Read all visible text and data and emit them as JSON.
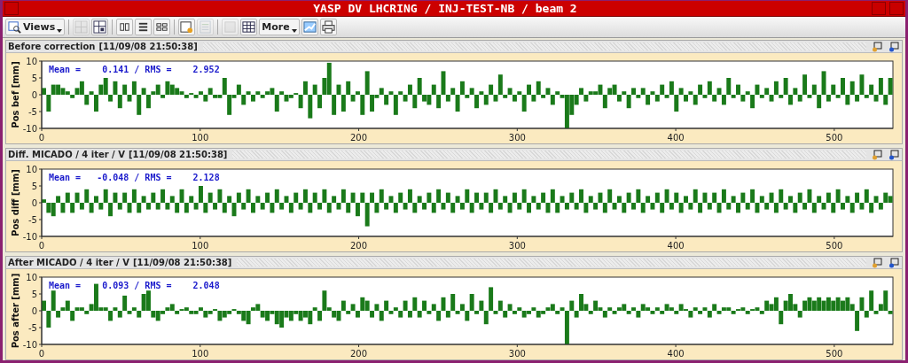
{
  "window": {
    "title": "YASP DV LHCRING / INJ-TEST-NB / beam 2"
  },
  "toolbar": [
    {
      "kind": "views",
      "label": "Views",
      "disabled": false
    },
    {
      "kind": "grid",
      "disabled": true
    },
    {
      "kind": "split",
      "disabled": false
    },
    {
      "kind": "columns",
      "disabled": false
    },
    {
      "kind": "rows",
      "disabled": false
    },
    {
      "kind": "tiles",
      "disabled": false
    },
    {
      "kind": "doc-gear",
      "disabled": false
    },
    {
      "kind": "list",
      "disabled": true
    },
    {
      "kind": "blank",
      "disabled": true
    },
    {
      "kind": "table",
      "disabled": false
    },
    {
      "kind": "more",
      "label": "More",
      "disabled": false
    },
    {
      "kind": "chart",
      "disabled": false
    },
    {
      "kind": "print",
      "disabled": false
    }
  ],
  "panels": [
    {
      "title": "Before correction",
      "timestamp": "[11/09/08 21:50:38]",
      "stats": "Mean =    0.141 / RMS =    2.952",
      "chart_data": {
        "type": "bar",
        "ylabel": "Pos bef [mm]",
        "xlim": [
          0,
          537
        ],
        "ylim": [
          -10,
          10
        ],
        "xticks": [
          0,
          100,
          200,
          300,
          400,
          500
        ],
        "yticks": [
          -10,
          -5,
          0,
          5,
          10
        ],
        "x": [
          1.5,
          4.5,
          7.5,
          10.5,
          13.5,
          16.5,
          19.5,
          22.5,
          25.5,
          28.5,
          31.5,
          34.5,
          37.5,
          40.5,
          43.5,
          46.5,
          49.5,
          52.5,
          55.5,
          58.5,
          61.5,
          64.5,
          67.5,
          70.5,
          73.5,
          76.5,
          79.5,
          82.5,
          85.5,
          88.5,
          91.5,
          94.5,
          97.5,
          100.5,
          103.5,
          106.5,
          109.5,
          112.5,
          115.5,
          118.5,
          121.5,
          124.5,
          127.5,
          130.5,
          133.5,
          136.5,
          139.5,
          142.5,
          145.5,
          148.5,
          151.5,
          154.5,
          157.5,
          160.5,
          163.5,
          166.5,
          169.5,
          172.5,
          175.5,
          178.5,
          181.5,
          184.5,
          187.5,
          190.5,
          193.5,
          196.5,
          199.5,
          202.5,
          205.5,
          208.5,
          211.5,
          214.5,
          217.5,
          220.5,
          223.5,
          226.5,
          229.5,
          232.5,
          235.5,
          238.5,
          241.5,
          244.5,
          247.5,
          250.5,
          253.5,
          256.5,
          259.5,
          262.5,
          265.5,
          268.5,
          271.5,
          274.5,
          277.5,
          280.5,
          283.5,
          286.5,
          289.5,
          292.5,
          295.5,
          298.5,
          301.5,
          304.5,
          307.5,
          310.5,
          313.5,
          316.5,
          319.5,
          322.5,
          325.5,
          328.5,
          331.5,
          334.5,
          337.5,
          340.5,
          343.5,
          346.5,
          349.5,
          352.5,
          355.5,
          358.5,
          361.5,
          364.5,
          367.5,
          370.5,
          373.5,
          376.5,
          379.5,
          382.5,
          385.5,
          388.5,
          391.5,
          394.5,
          397.5,
          400.5,
          403.5,
          406.5,
          409.5,
          412.5,
          415.5,
          418.5,
          421.5,
          424.5,
          427.5,
          430.5,
          433.5,
          436.5,
          439.5,
          442.5,
          445.5,
          448.5,
          451.5,
          454.5,
          457.5,
          460.5,
          463.5,
          466.5,
          469.5,
          472.5,
          475.5,
          478.5,
          481.5,
          484.5,
          487.5,
          490.5,
          493.5,
          496.5,
          499.5,
          502.5,
          505.5,
          508.5,
          511.5,
          514.5,
          517.5,
          520.5,
          523.5,
          526.5,
          529.5,
          532.5,
          535.5
        ],
        "series": [
          {
            "color": "#1a7a1a",
            "values": [
              2,
              -5,
              3,
              3,
              2,
              1,
              -1,
              2,
              4,
              -3,
              1,
              -5,
              3,
              5,
              -2,
              4,
              -4,
              3,
              -2,
              4,
              -6,
              2,
              -4,
              1,
              3,
              -1,
              4,
              3,
              2,
              1,
              -1,
              0.5,
              -1,
              1,
              -2,
              2,
              -1,
              -1,
              5,
              -6,
              -1,
              3,
              -3,
              1,
              -2,
              1,
              -1,
              1,
              2,
              -5,
              1,
              -2,
              -1,
              0.5,
              -4,
              4,
              -7,
              3,
              -4,
              5,
              9.5,
              -6,
              3,
              -5,
              4,
              -2,
              1,
              -6,
              7,
              -5,
              -1,
              2,
              -3,
              1,
              -6,
              1,
              -2,
              3,
              -4,
              5,
              -2,
              -3,
              3,
              -4,
              7,
              -2,
              2,
              -5,
              4,
              -1,
              2,
              -4,
              1,
              -3,
              3,
              -2,
              6,
              -1,
              2,
              -2,
              1,
              -5,
              3,
              -2,
              4,
              -1,
              2,
              -3,
              1,
              -1,
              -10,
              -6,
              -3,
              2,
              -2,
              1,
              1,
              3,
              -4,
              2,
              3,
              -2,
              1,
              -4,
              2,
              -1,
              2,
              -3,
              1,
              -2,
              3,
              -1,
              4,
              -5,
              2,
              -2,
              1,
              -3,
              3,
              -1,
              4,
              -2,
              2,
              -3,
              5,
              -1,
              3,
              -2,
              1,
              -4,
              3,
              -1,
              2,
              -2,
              4,
              -1,
              5,
              -3,
              2,
              -2,
              6,
              -1,
              3,
              -4,
              7,
              -2,
              3,
              -1,
              5,
              -3,
              4,
              -2,
              6,
              -1,
              3,
              -2,
              5,
              -3,
              5
            ]
          }
        ]
      }
    },
    {
      "title": "Diff. MICADO / 4 iter / V",
      "timestamp": "[11/09/08 21:50:38]",
      "stats": "Mean =   -0.048 / RMS =    2.128",
      "chart_data": {
        "type": "bar",
        "ylabel": "Pos diff [mm]",
        "xlim": [
          0,
          537
        ],
        "ylim": [
          -10,
          10
        ],
        "xticks": [
          0,
          100,
          200,
          300,
          400,
          500
        ],
        "yticks": [
          -10,
          -5,
          0,
          5,
          10
        ],
        "x": [
          1.5,
          4.5,
          7.5,
          10.5,
          13.5,
          16.5,
          19.5,
          22.5,
          25.5,
          28.5,
          31.5,
          34.5,
          37.5,
          40.5,
          43.5,
          46.5,
          49.5,
          52.5,
          55.5,
          58.5,
          61.5,
          64.5,
          67.5,
          70.5,
          73.5,
          76.5,
          79.5,
          82.5,
          85.5,
          88.5,
          91.5,
          94.5,
          97.5,
          100.5,
          103.5,
          106.5,
          109.5,
          112.5,
          115.5,
          118.5,
          121.5,
          124.5,
          127.5,
          130.5,
          133.5,
          136.5,
          139.5,
          142.5,
          145.5,
          148.5,
          151.5,
          154.5,
          157.5,
          160.5,
          163.5,
          166.5,
          169.5,
          172.5,
          175.5,
          178.5,
          181.5,
          184.5,
          187.5,
          190.5,
          193.5,
          196.5,
          199.5,
          202.5,
          205.5,
          208.5,
          211.5,
          214.5,
          217.5,
          220.5,
          223.5,
          226.5,
          229.5,
          232.5,
          235.5,
          238.5,
          241.5,
          244.5,
          247.5,
          250.5,
          253.5,
          256.5,
          259.5,
          262.5,
          265.5,
          268.5,
          271.5,
          274.5,
          277.5,
          280.5,
          283.5,
          286.5,
          289.5,
          292.5,
          295.5,
          298.5,
          301.5,
          304.5,
          307.5,
          310.5,
          313.5,
          316.5,
          319.5,
          322.5,
          325.5,
          328.5,
          331.5,
          334.5,
          337.5,
          340.5,
          343.5,
          346.5,
          349.5,
          352.5,
          355.5,
          358.5,
          361.5,
          364.5,
          367.5,
          370.5,
          373.5,
          376.5,
          379.5,
          382.5,
          385.5,
          388.5,
          391.5,
          394.5,
          397.5,
          400.5,
          403.5,
          406.5,
          409.5,
          412.5,
          415.5,
          418.5,
          421.5,
          424.5,
          427.5,
          430.5,
          433.5,
          436.5,
          439.5,
          442.5,
          445.5,
          448.5,
          451.5,
          454.5,
          457.5,
          460.5,
          463.5,
          466.5,
          469.5,
          472.5,
          475.5,
          478.5,
          481.5,
          484.5,
          487.5,
          490.5,
          493.5,
          496.5,
          499.5,
          502.5,
          505.5,
          508.5,
          511.5,
          514.5,
          517.5,
          520.5,
          523.5,
          526.5,
          529.5,
          532.5,
          535.5
        ],
        "series": [
          {
            "color": "#1a7a1a",
            "values": [
              1,
              -3,
              -4,
              2,
              -3,
              3,
              -3,
              3,
              -2,
              4,
              -3,
              2,
              -2,
              4,
              -4,
              3,
              -2,
              3,
              -3,
              4,
              -3,
              2,
              -2,
              3,
              -2,
              4,
              -2,
              2,
              -3,
              4,
              -3,
              2,
              -2,
              5,
              -3,
              3,
              -2,
              4,
              -3,
              2,
              -4,
              3,
              -2,
              4,
              -3,
              2,
              -2,
              3,
              -3,
              4,
              -2,
              2,
              -3,
              3,
              -2,
              4,
              -3,
              3,
              -2,
              4,
              -3,
              2,
              -2,
              4,
              -3,
              3,
              -4,
              3,
              -7,
              3,
              -3,
              4,
              -2,
              2,
              -3,
              3,
              -2,
              4,
              -3,
              2,
              -2,
              3,
              -3,
              4,
              -2,
              3,
              -3,
              2,
              -2,
              4,
              -3,
              3,
              -2,
              3,
              -3,
              4,
              -2,
              2,
              -3,
              3,
              -2,
              4,
              -3,
              2,
              -2,
              3,
              -3,
              4,
              -3,
              2,
              -2,
              3,
              -2,
              4,
              -3,
              2,
              -2,
              3,
              -3,
              4,
              -2,
              2,
              -3,
              3,
              -2,
              4,
              -3,
              2,
              -2,
              3,
              -3,
              4,
              -2,
              3,
              -3,
              2,
              -2,
              4,
              -3,
              3,
              -2,
              3,
              -3,
              4,
              -2,
              2,
              -3,
              3,
              -2,
              4,
              -3,
              2,
              -2,
              3,
              -3,
              4,
              -2,
              2,
              -3,
              3,
              -2,
              4,
              -3,
              2,
              -2,
              3,
              -3,
              4,
              -2,
              2,
              -3,
              3,
              -2,
              4,
              -3,
              2,
              -2,
              3,
              2
            ]
          }
        ]
      }
    },
    {
      "title": "After MICADO / 4 iter / V",
      "timestamp": "[11/09/08 21:50:38]",
      "stats": "Mean =    0.093 / RMS =    2.048",
      "chart_data": {
        "type": "bar",
        "ylabel": "Pos after [mm]",
        "xlim": [
          0,
          537
        ],
        "ylim": [
          -10,
          10
        ],
        "xticks": [
          0,
          100,
          200,
          300,
          400,
          500
        ],
        "yticks": [
          -10,
          -5,
          0,
          5,
          10
        ],
        "x": [
          1.5,
          4.5,
          7.5,
          10.5,
          13.5,
          16.5,
          19.5,
          22.5,
          25.5,
          28.5,
          31.5,
          34.5,
          37.5,
          40.5,
          43.5,
          46.5,
          49.5,
          52.5,
          55.5,
          58.5,
          61.5,
          64.5,
          67.5,
          70.5,
          73.5,
          76.5,
          79.5,
          82.5,
          85.5,
          88.5,
          91.5,
          94.5,
          97.5,
          100.5,
          103.5,
          106.5,
          109.5,
          112.5,
          115.5,
          118.5,
          121.5,
          124.5,
          127.5,
          130.5,
          133.5,
          136.5,
          139.5,
          142.5,
          145.5,
          148.5,
          151.5,
          154.5,
          157.5,
          160.5,
          163.5,
          166.5,
          169.5,
          172.5,
          175.5,
          178.5,
          181.5,
          184.5,
          187.5,
          190.5,
          193.5,
          196.5,
          199.5,
          202.5,
          205.5,
          208.5,
          211.5,
          214.5,
          217.5,
          220.5,
          223.5,
          226.5,
          229.5,
          232.5,
          235.5,
          238.5,
          241.5,
          244.5,
          247.5,
          250.5,
          253.5,
          256.5,
          259.5,
          262.5,
          265.5,
          268.5,
          271.5,
          274.5,
          277.5,
          280.5,
          283.5,
          286.5,
          289.5,
          292.5,
          295.5,
          298.5,
          301.5,
          304.5,
          307.5,
          310.5,
          313.5,
          316.5,
          319.5,
          322.5,
          325.5,
          328.5,
          331.5,
          334.5,
          337.5,
          340.5,
          343.5,
          346.5,
          349.5,
          352.5,
          355.5,
          358.5,
          361.5,
          364.5,
          367.5,
          370.5,
          373.5,
          376.5,
          379.5,
          382.5,
          385.5,
          388.5,
          391.5,
          394.5,
          397.5,
          400.5,
          403.5,
          406.5,
          409.5,
          412.5,
          415.5,
          418.5,
          421.5,
          424.5,
          427.5,
          430.5,
          433.5,
          436.5,
          439.5,
          442.5,
          445.5,
          448.5,
          451.5,
          454.5,
          457.5,
          460.5,
          463.5,
          466.5,
          469.5,
          472.5,
          475.5,
          478.5,
          481.5,
          484.5,
          487.5,
          490.5,
          493.5,
          496.5,
          499.5,
          502.5,
          505.5,
          508.5,
          511.5,
          514.5,
          517.5,
          520.5,
          523.5,
          526.5,
          529.5,
          532.5,
          535.5
        ],
        "series": [
          {
            "color": "#1a7a1a",
            "values": [
              3,
              -5,
              6,
              -2,
              1,
              3,
              -3,
              1,
              1,
              -1,
              2,
              8,
              1,
              1,
              -3,
              1,
              -2,
              4.5,
              -1,
              1,
              -2,
              5,
              6,
              -2,
              -3,
              -1,
              1,
              2,
              -1,
              0.5,
              1,
              -1,
              -1,
              1,
              -2,
              -1,
              0.5,
              -3,
              -2,
              -1,
              0.5,
              -1,
              -3,
              -4,
              1,
              2,
              -2,
              -3,
              -1,
              -4,
              -5,
              -2,
              -3,
              -1,
              -3,
              -2,
              -4,
              1,
              -3,
              6,
              1,
              -2,
              -3,
              3,
              -1,
              2,
              -2,
              4,
              3,
              -2,
              2,
              -3,
              3,
              -1,
              1,
              -2,
              3,
              -2,
              4,
              -2,
              3,
              -1,
              2,
              -3,
              4,
              -2,
              5,
              -1,
              2,
              -3,
              5,
              -1,
              3,
              -4,
              7,
              -1,
              3,
              -2,
              2,
              -1,
              1,
              -2,
              -1,
              1,
              -2,
              -1,
              1,
              2,
              -1,
              1,
              -10,
              3,
              -2,
              5,
              2,
              -1,
              3,
              1,
              -2,
              1,
              -1,
              1,
              2,
              -1,
              1,
              -2,
              2,
              1,
              -1,
              1,
              -1,
              2,
              1,
              -1,
              2,
              0.5,
              -2,
              1,
              -1,
              1,
              -2,
              2,
              -1,
              1,
              1,
              -1,
              0.5,
              1,
              -1,
              0.5,
              1,
              -1,
              3,
              2,
              4,
              -4,
              3,
              5,
              2,
              -2,
              3,
              4,
              3,
              4,
              3,
              4,
              3,
              4,
              3,
              4,
              2,
              -6,
              4,
              -2,
              6,
              -1,
              2,
              6,
              -1
            ]
          }
        ]
      }
    }
  ]
}
